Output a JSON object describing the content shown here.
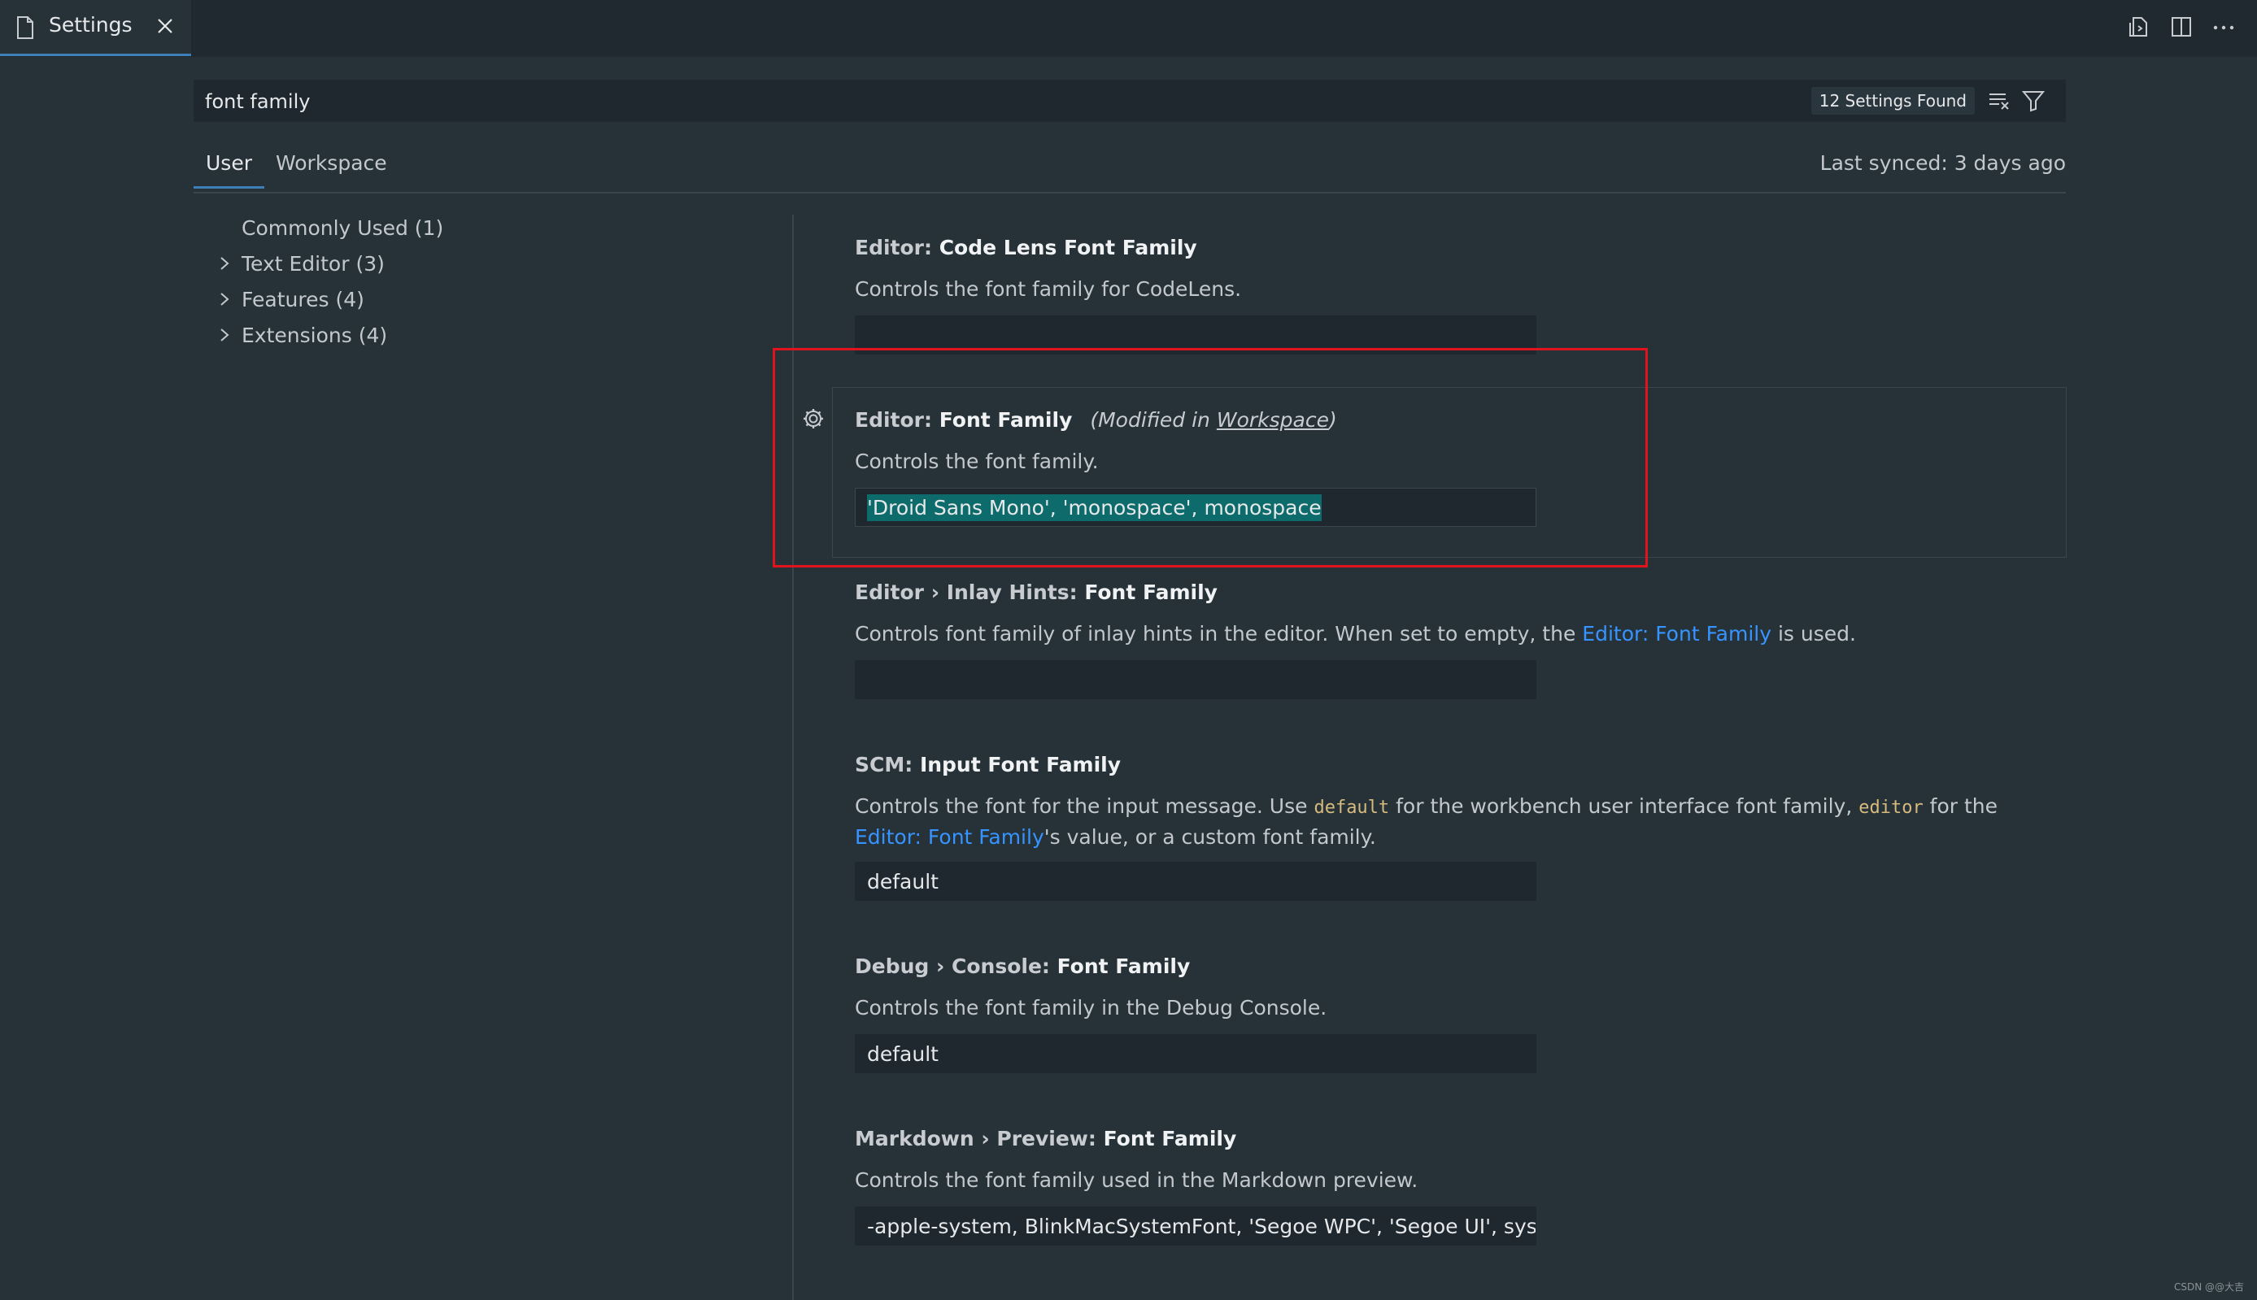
{
  "tab": {
    "label": "Settings"
  },
  "search": {
    "value": "font family",
    "result_count": "12 Settings Found"
  },
  "scope_tabs": {
    "user": "User",
    "workspace": "Workspace",
    "last_synced": "Last synced: 3 days ago"
  },
  "toc": [
    {
      "label": "Commonly Used (1)",
      "expandable": false
    },
    {
      "label": "Text Editor (3)",
      "expandable": true
    },
    {
      "label": "Features (4)",
      "expandable": true
    },
    {
      "label": "Extensions (4)",
      "expandable": true
    }
  ],
  "settings": {
    "code_lens": {
      "category": "Editor: ",
      "name": "Code Lens Font Family",
      "description": "Controls the font family for CodeLens.",
      "value": ""
    },
    "font_family": {
      "category": "Editor: ",
      "name": "Font Family",
      "modified_prefix": "(Modified in ",
      "modified_link": "Workspace",
      "modified_suffix": ")",
      "description": "Controls the font family.",
      "value": "'Droid Sans Mono', 'monospace', monospace"
    },
    "inlay_hints": {
      "category": "Editor › Inlay Hints: ",
      "name": "Font Family",
      "description_before": "Controls font family of inlay hints in the editor. When set to empty, the ",
      "description_link": "Editor: Font Family",
      "description_after": " is used.",
      "value": ""
    },
    "scm": {
      "category": "SCM: ",
      "name": "Input Font Family",
      "desc_1": "Controls the font for the input message. Use ",
      "code_1": "default",
      "desc_2": " for the workbench user interface font family, ",
      "code_2": "editor",
      "desc_3": " for the ",
      "link": "Editor: Font Family",
      "desc_4": "'s value, or a custom font family.",
      "value": "default"
    },
    "debug_console": {
      "category": "Debug › Console: ",
      "name": "Font Family",
      "description": "Controls the font family in the Debug Console.",
      "value": "default"
    },
    "markdown_preview": {
      "category": "Markdown › Preview: ",
      "name": "Font Family",
      "description": "Controls the font family used in the Markdown preview.",
      "value": "-apple-system, BlinkMacSystemFont, 'Segoe WPC', 'Segoe UI', syst..."
    }
  },
  "watermark": "CSDN @@大吉",
  "colors": {
    "accent": "#3d7fb6",
    "link": "#3794ff",
    "highlight_border": "#e1141e",
    "selection": "#0e6b6b"
  }
}
